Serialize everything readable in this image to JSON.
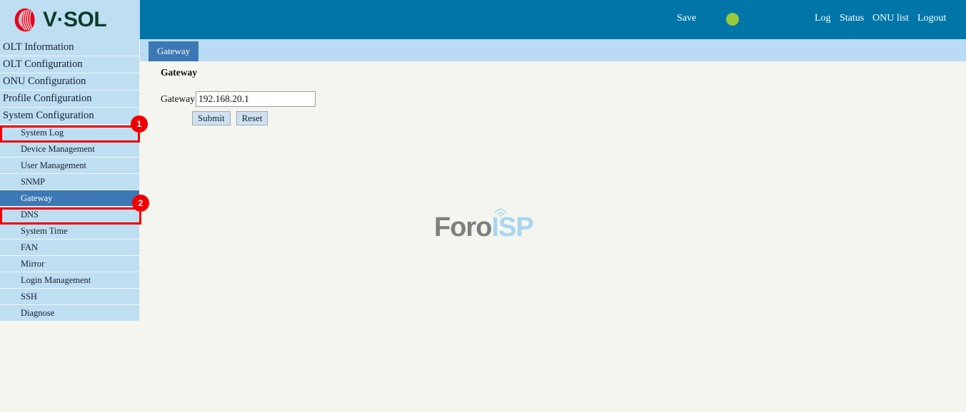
{
  "brand": {
    "logo_icon": "vsol-swirl-icon",
    "logo_text": "V·SOL"
  },
  "topbar": {
    "save_label": "Save",
    "status_led": {
      "icon": "status-led-icon",
      "color": "#9aca3c"
    },
    "log_label": "Log",
    "status_label": "Status",
    "onu_list_label": "ONU list",
    "logout_label": "Logout",
    "background_color": "#0076a8"
  },
  "sidebar": {
    "background_color": "#bedef2",
    "selected_color": "#3c78b5",
    "top_items": [
      {
        "label": "OLT Information"
      },
      {
        "label": "OLT Configuration"
      },
      {
        "label": "ONU Configuration"
      },
      {
        "label": "Profile Configuration"
      },
      {
        "label": "System Configuration"
      }
    ],
    "sub_items": [
      {
        "label": "System Log",
        "selected": false
      },
      {
        "label": "Device Management",
        "selected": false
      },
      {
        "label": "User Management",
        "selected": false
      },
      {
        "label": "SNMP",
        "selected": false
      },
      {
        "label": "Gateway",
        "selected": true
      },
      {
        "label": "DNS",
        "selected": false
      },
      {
        "label": "System Time",
        "selected": false
      },
      {
        "label": "FAN",
        "selected": false
      },
      {
        "label": "Mirror",
        "selected": false
      },
      {
        "label": "Login Management",
        "selected": false
      },
      {
        "label": "SSH",
        "selected": false
      },
      {
        "label": "Diagnose",
        "selected": false
      }
    ]
  },
  "annotations": {
    "color": "#f00000",
    "items": [
      {
        "badge": "1",
        "target": "System Configuration"
      },
      {
        "badge": "2",
        "target": "Gateway"
      }
    ]
  },
  "main": {
    "tab_label": "Gateway",
    "panel_title": "Gateway",
    "form": {
      "gateway_label": "Gateway",
      "gateway_value": "192.168.20.1",
      "gateway_placeholder": "",
      "submit_label": "Submit",
      "reset_label": "Reset"
    }
  },
  "watermark": {
    "text_primary": "Foro",
    "text_secondary": "ISP",
    "icon": "antenna-signal-icon"
  }
}
